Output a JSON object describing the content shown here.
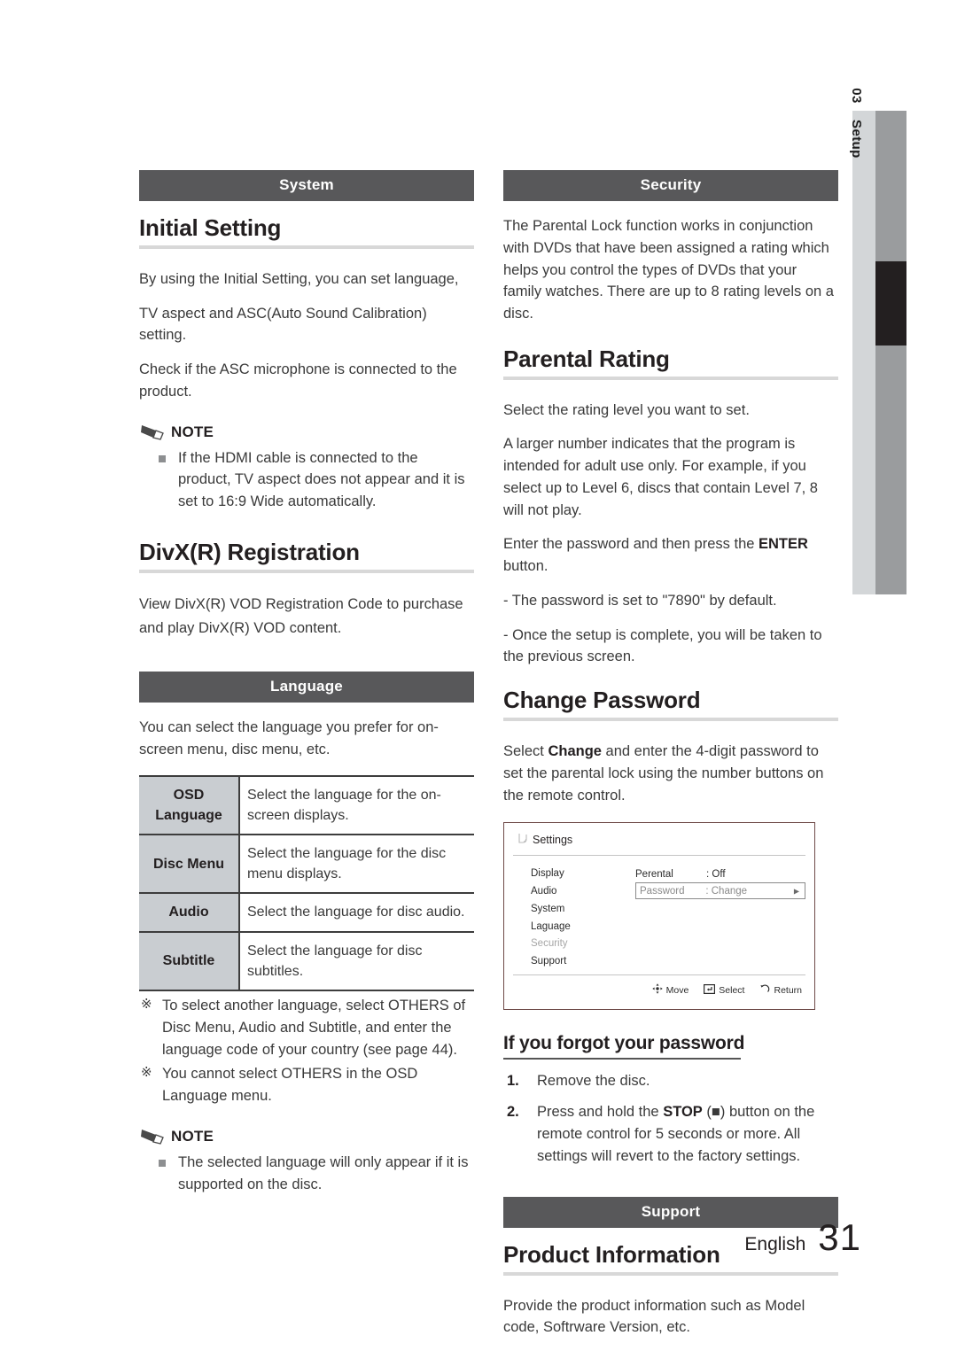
{
  "side_tab": {
    "chapter_number": "03",
    "chapter_label": "Setup"
  },
  "left_column": {
    "section_bar": "System",
    "initial_setting": {
      "heading": "Initial Setting",
      "paragraph_1": "By using the Initial Setting, you can set language,",
      "paragraph_2": "TV aspect and ASC(Auto Sound Calibration) setting.",
      "paragraph_3": "Check if the ASC microphone is connected to the product.",
      "note_label": "NOTE",
      "note_items": [
        "If the HDMI cable is connected to the product, TV aspect does not appear and it is set to 16:9 Wide automatically."
      ]
    },
    "divx_registration": {
      "heading": "DivX(R) Registration",
      "paragraph_1": "View DivX(R) VOD Registration Code to purchase and play DivX(R) VOD content."
    },
    "language": {
      "section_bar": "Language",
      "paragraph_1": "You can select the language you prefer for on-screen menu, disc menu, etc.",
      "table": [
        {
          "key": "OSD Language",
          "value": "Select the language for the on-screen displays."
        },
        {
          "key": "Disc Menu",
          "value": "Select the language for the disc menu displays."
        },
        {
          "key": "Audio",
          "value": "Select the language for disc audio."
        },
        {
          "key": "Subtitle",
          "value": "Select the language for disc subtitles."
        }
      ],
      "kome_symbol": "※",
      "kome_notes": [
        "To select another language, select OTHERS of Disc Menu, Audio and Subtitle, and enter the language code of your country (see page 44).",
        "You cannot select OTHERS in the OSD Language menu."
      ],
      "note_label": "NOTE",
      "note_items": [
        "The selected language will only appear if it is supported on the disc."
      ]
    }
  },
  "right_column": {
    "section_bar": "Security",
    "security_intro": "The Parental Lock function works in conjunction with DVDs that have been assigned a rating which helps you control the types of DVDs that your family watches. There are up to 8 rating levels on a disc.",
    "parental_rating": {
      "heading": "Parental Rating",
      "paragraph_1": "Select the rating level you want to set.",
      "paragraph_2": "A larger number indicates that the program is intended for adult use only. For example, if you select up to Level 6, discs that contain Level 7, 8 will not play.",
      "paragraph_3_pre": "Enter the password and then press the ",
      "paragraph_3_bold": "ENTER",
      "paragraph_3_post": " button.",
      "dash_items": [
        "- The password is set to \"7890\" by default.",
        "- Once the setup is complete, you will be taken to the previous screen."
      ]
    },
    "change_password": {
      "heading": "Change Password",
      "paragraph_pre": "Select ",
      "paragraph_bold": "Change",
      "paragraph_post": " and enter the 4-digit password to set the parental lock using the number buttons on the remote control."
    },
    "osd_screen": {
      "title": "Settings",
      "menu_items": [
        {
          "label": "Display",
          "muted": false
        },
        {
          "label": "Audio",
          "muted": false
        },
        {
          "label": "System",
          "muted": false
        },
        {
          "label": "Laguage",
          "muted": false
        },
        {
          "label": "Security",
          "muted": true
        },
        {
          "label": "Support",
          "muted": false
        }
      ],
      "rows": [
        {
          "key": "Perental",
          "value": ": Off",
          "selected": false
        },
        {
          "key": "Password",
          "value": ": Change",
          "selected": true
        }
      ],
      "footer_hints": [
        {
          "icon": "dpad-icon",
          "label": "Move"
        },
        {
          "icon": "enter-key-icon",
          "label": "Select"
        },
        {
          "icon": "return-arrow-icon",
          "label": "Return"
        }
      ]
    },
    "forgot_password": {
      "heading": "If you forgot your password",
      "steps": [
        {
          "num": "1.",
          "text": "Remove the disc."
        },
        {
          "num": "2.",
          "text_pre": "Press and hold the ",
          "text_bold": "STOP",
          "text_mid": " (■) button on the ",
          "text_post": "remote control for 5 seconds or more. All settings will revert to the factory settings."
        }
      ]
    },
    "support": {
      "section_bar": "Support",
      "product_information": {
        "heading": "Product Information",
        "paragraph_1": "Provide the product information such as Model code, Softrware Version, etc."
      }
    }
  },
  "footer": {
    "language": "English",
    "page_number": "31"
  }
}
